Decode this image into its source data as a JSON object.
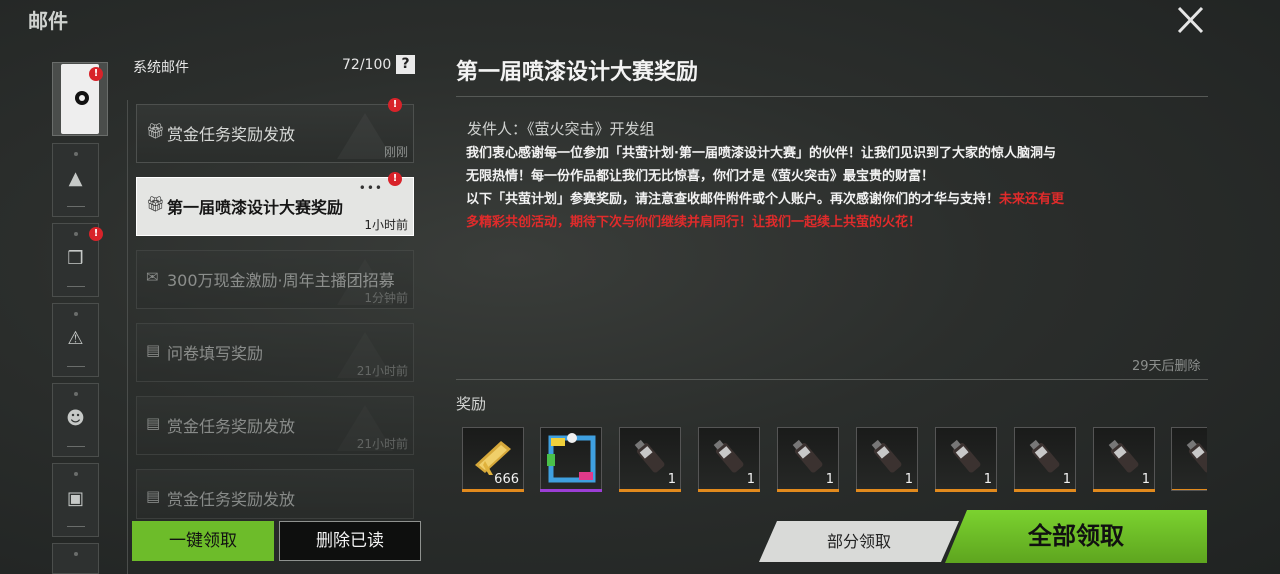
{
  "page": {
    "title": "邮件"
  },
  "mail_list": {
    "header": "系统邮件",
    "count": "72/100",
    "help": "?",
    "items": [
      {
        "title": "赏金任务奖励发放",
        "time": "刚刚",
        "unread": true
      },
      {
        "title": "第一届喷漆设计大赛奖励",
        "time": "1小时前",
        "unread": true,
        "selected": true
      },
      {
        "title": "300万现金激励·周年主播团招募",
        "time": "1分钟前"
      },
      {
        "title": "问卷填写奖励",
        "time": "21小时前"
      },
      {
        "title": "赏金任务奖励发放",
        "time": "21小时前"
      },
      {
        "title": "赏金任务奖励发放",
        "time": ""
      }
    ],
    "collect_all_label": "一键领取",
    "delete_read_label": "删除已读"
  },
  "detail": {
    "title": "第一届喷漆设计大赛奖励",
    "sender": "发件人：《萤火突击》开发组",
    "body_1": "我们衷心感谢每一位参加「共萤计划·第一届喷漆设计大赛」的伙伴！让我们见识到了大家的惊人脑洞与无限热情！每一份作品都让我们无比惊喜，你们才是《萤火突击》最宝贵的财富！",
    "body_2": "以下「共萤计划」参赛奖励，请注意查收邮件附件或个人账户。再次感谢你们的才华与支持！",
    "body_highlight": "未来还有更多精彩共创活动，期待下次与你们继续并肩同行！让我们一起续上共萤的火花！",
    "expire": "29天后删除",
    "rewards_label": "奖励",
    "rewards": [
      {
        "icon": "gold-ticket-icon",
        "qty": "666",
        "rarity": "orange"
      },
      {
        "icon": "spray-frame-icon",
        "qty": "",
        "rarity": "purple"
      },
      {
        "icon": "spray-can-icon",
        "qty": "1",
        "rarity": "orange"
      },
      {
        "icon": "spray-can-icon",
        "qty": "1",
        "rarity": "orange"
      },
      {
        "icon": "spray-can-icon",
        "qty": "1",
        "rarity": "orange"
      },
      {
        "icon": "spray-can-icon",
        "qty": "1",
        "rarity": "orange"
      },
      {
        "icon": "spray-can-icon",
        "qty": "1",
        "rarity": "orange"
      },
      {
        "icon": "spray-can-icon",
        "qty": "1",
        "rarity": "orange"
      },
      {
        "icon": "spray-can-icon",
        "qty": "1",
        "rarity": "orange"
      },
      {
        "icon": "spray-can-icon",
        "qty": "",
        "rarity": "orange"
      }
    ],
    "partial_label": "部分领取",
    "claim_all_label": "全部领取"
  },
  "colors": {
    "accent_green": "#6dbc2a",
    "badge_red": "#d8232a",
    "highlight_red": "#e02b2b"
  }
}
